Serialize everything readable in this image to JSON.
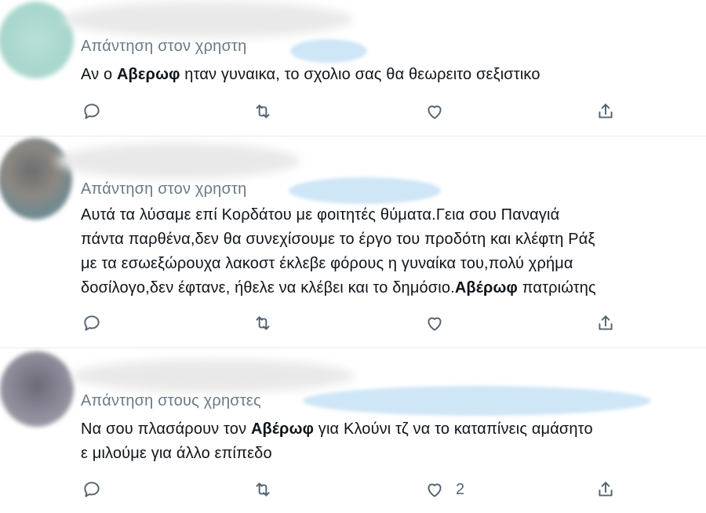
{
  "tweets": [
    {
      "reply_prefix": "Απάντηση στον χρηστη",
      "segments": [
        [
          "Αν ο ",
          "",
          "ηταν γυναικα, το σχολιο σας θα θεωρειτο σεξιστικο"
        ],
        [
          "Αβερωφ"
        ]
      ],
      "actions": {
        "like_count": ""
      }
    },
    {
      "reply_prefix": "Απάντηση στον χρηστη",
      "lines": [
        "Αυτά τα λύσαμε επί Κορδάτου με φοιτητές θύματα.Γεια σου Παναγιά",
        "πάντα παρθένα,δεν θα συνεχίσουμε το έργο του προδότη και κλέφτη Ράξ",
        "με τα εσωεξώρουχα λακοστ έκλεβε φόρους η γυναίκα του,πολύ χρήμα"
      ],
      "last_line_pre": "δοσίλογο,δεν έφτανε, ήθελε να κλέβει και το δημόσιο.",
      "last_line_bold": "Αβέρωφ",
      "last_line_post": " πατριώτης",
      "actions": {
        "like_count": ""
      }
    },
    {
      "reply_prefix": "Απάντηση στους χρηστες",
      "line1_pre": "Να σου πλασάρουν τον ",
      "line1_bold": "Αβέρωφ",
      "line1_post": " για Κλούνι τζ να το καταπίνεις αμάσητο",
      "line2": "ε μιλούμε για άλλο επίπεδο",
      "actions": {
        "like_count": "2"
      }
    }
  ],
  "tweet1": {
    "pre": "Αν ο ",
    "bold": "Αβερωφ",
    "post": " ηταν γυναικα, το σχολιο σας θα θεωρειτο σεξιστικο"
  },
  "icons": [
    "reply-icon",
    "retweet-icon",
    "like-icon",
    "share-icon"
  ],
  "colors": {
    "text": "#0f1419",
    "secondary": "#6b7a86",
    "icon": "#536471",
    "divider": "#e6ecf0",
    "handle_highlight": "#cfe6f7"
  }
}
